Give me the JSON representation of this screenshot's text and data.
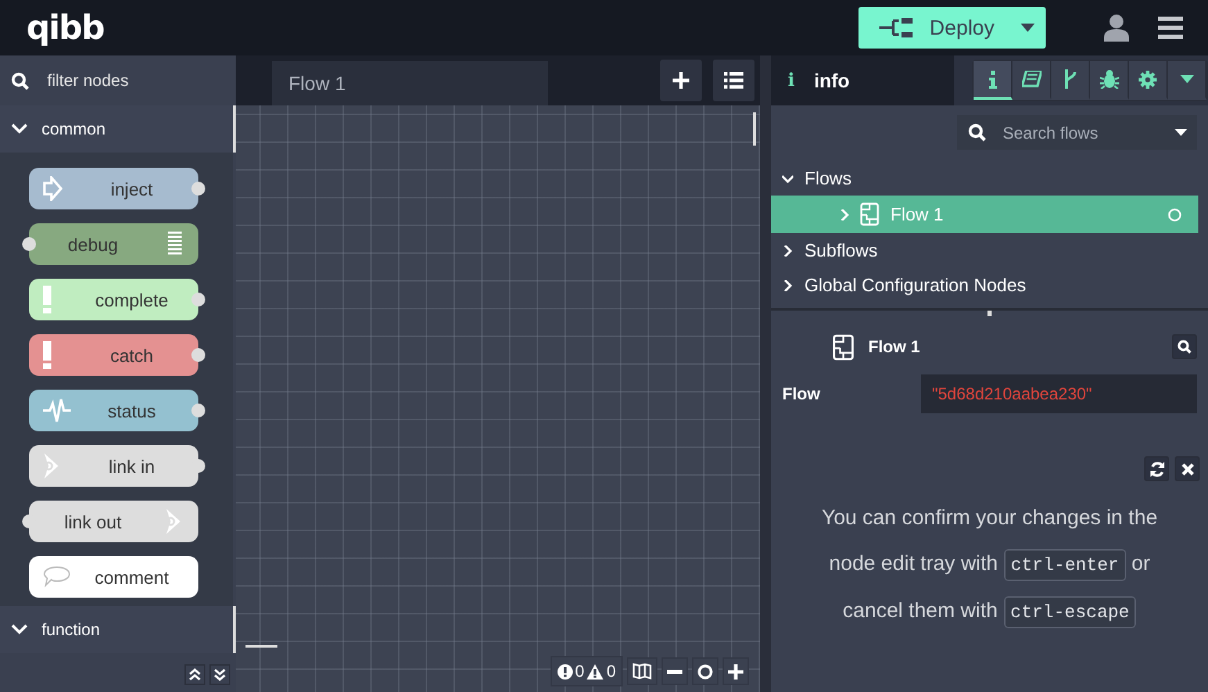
{
  "header": {
    "logo": "qibb",
    "deploy": {
      "label": "Deploy"
    }
  },
  "palette": {
    "filter": {
      "placeholder": "filter nodes"
    },
    "categories": [
      {
        "label": "common",
        "expanded": true,
        "nodes": [
          {
            "label": "inject",
            "kind": "arrow",
            "color": "#a6bbcf",
            "input": false,
            "output": true
          },
          {
            "label": "debug",
            "kind": "bars",
            "color": "#87a980",
            "input": true,
            "output": false
          },
          {
            "label": "complete",
            "kind": "exclaim",
            "color": "#c0edc0",
            "input": false,
            "output": true
          },
          {
            "label": "catch",
            "kind": "exclaim",
            "color": "#e49191",
            "input": false,
            "output": true
          },
          {
            "label": "status",
            "kind": "pulse",
            "color": "#94c1d0",
            "input": false,
            "output": true
          },
          {
            "label": "link in",
            "kind": "link",
            "color": "#dddddd",
            "input": false,
            "output": true
          },
          {
            "label": "link out",
            "kind": "link",
            "color": "#dddddd",
            "input": true,
            "output": false
          },
          {
            "label": "comment",
            "kind": "speech",
            "color": "#ffffff",
            "input": false,
            "output": false
          }
        ]
      },
      {
        "label": "function",
        "expanded": true
      }
    ]
  },
  "workspace": {
    "tabs": [
      {
        "label": "Flow 1",
        "selected": true
      }
    ],
    "status": {
      "errors": "0",
      "warnings": "0"
    }
  },
  "sidebar": {
    "tab": {
      "icon": "i",
      "label": "info"
    },
    "buttons": [
      {
        "kind": "info",
        "selected": true
      },
      {
        "kind": "book",
        "selected": false
      },
      {
        "kind": "branch",
        "selected": false
      },
      {
        "kind": "bug",
        "selected": false
      },
      {
        "kind": "gear",
        "selected": false
      },
      {
        "kind": "caret",
        "selected": false
      }
    ],
    "search": {
      "placeholder": "Search flows"
    },
    "tree": [
      {
        "label": "Flows",
        "expanded": true,
        "children": [
          {
            "label": "Flow 1",
            "selected": true
          }
        ]
      },
      {
        "label": "Subflows",
        "expanded": false
      },
      {
        "label": "Global Configuration Nodes",
        "expanded": false
      }
    ],
    "detail": {
      "title": "Flow 1",
      "properties": [
        {
          "name": "Flow",
          "value": "\"5d68d210aabea230\""
        }
      ]
    },
    "tip": {
      "parts": [
        {
          "kind": "text",
          "text": "You can confirm your changes in the node edit tray with"
        },
        {
          "kind": "key",
          "text": "ctrl-enter"
        },
        {
          "kind": "text",
          "text": "or cancel them with"
        },
        {
          "kind": "key",
          "text": "ctrl-escape"
        }
      ]
    }
  }
}
